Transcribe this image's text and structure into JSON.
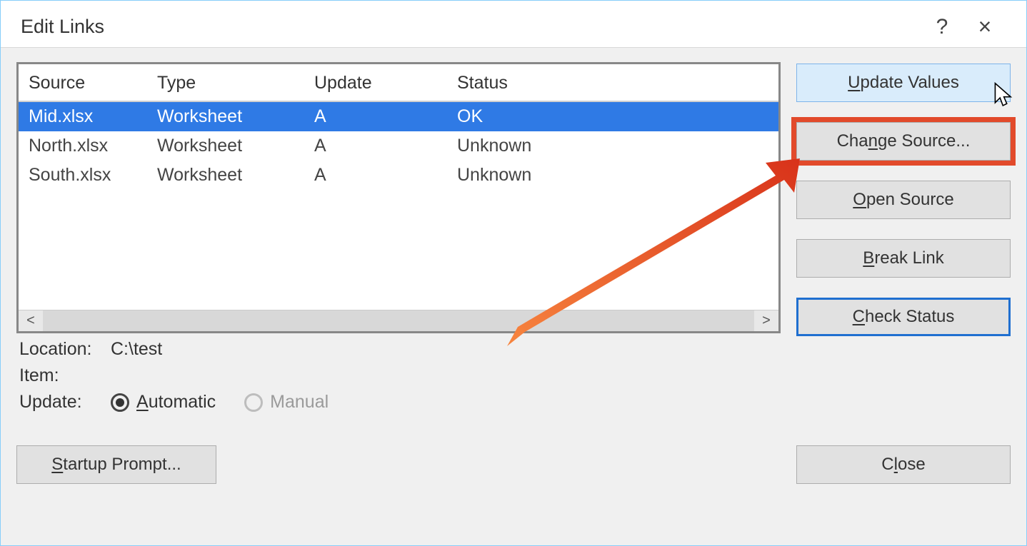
{
  "dialog": {
    "title": "Edit Links",
    "help_tooltip": "?",
    "close_tooltip": "×"
  },
  "columns": {
    "source": "Source",
    "type": "Type",
    "update": "Update",
    "status": "Status"
  },
  "links": [
    {
      "source": "Mid.xlsx",
      "type": "Worksheet",
      "update": "A",
      "status": "OK",
      "selected": true
    },
    {
      "source": "North.xlsx",
      "type": "Worksheet",
      "update": "A",
      "status": "Unknown",
      "selected": false
    },
    {
      "source": "South.xlsx",
      "type": "Worksheet",
      "update": "A",
      "status": "Unknown",
      "selected": false
    }
  ],
  "buttons": {
    "update_values_pre": "",
    "update_values_u": "U",
    "update_values_post": "pdate Values",
    "change_source_pre": "Cha",
    "change_source_u": "n",
    "change_source_post": "ge Source...",
    "open_source_pre": "",
    "open_source_u": "O",
    "open_source_post": "pen Source",
    "break_link_pre": "",
    "break_link_u": "B",
    "break_link_post": "reak Link",
    "check_status_pre": "",
    "check_status_u": "C",
    "check_status_post": "heck Status",
    "startup_prompt_pre": "",
    "startup_prompt_u": "S",
    "startup_prompt_post": "tartup Prompt...",
    "close_pre": "C",
    "close_u": "l",
    "close_post": "ose"
  },
  "info": {
    "location_label": "Location:",
    "location_value": "C:\\test",
    "item_label": "Item:",
    "item_value": "",
    "update_label": "Update:",
    "automatic_pre": "",
    "automatic_u": "A",
    "automatic_post": "utomatic",
    "manual_label": "Manual"
  },
  "scrollbar": {
    "left": "<",
    "right": ">"
  }
}
